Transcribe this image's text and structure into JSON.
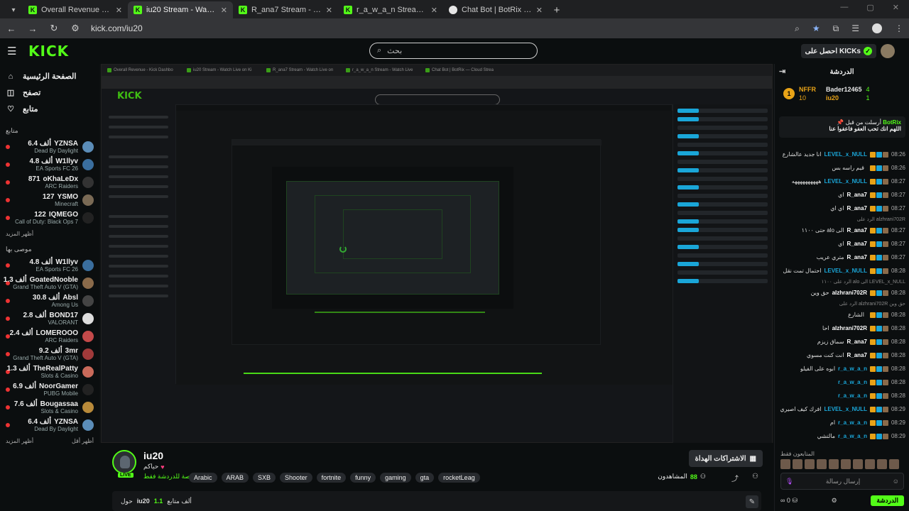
{
  "browser": {
    "tabs": [
      {
        "title": "Overall Revenue - Kick Dashbo",
        "active": false,
        "icon": "kick-icon"
      },
      {
        "title": "iu20 Stream - Watch Live on Ki",
        "active": true,
        "icon": "kick-icon"
      },
      {
        "title": "R_ana7 Stream - Watch Live on",
        "active": false,
        "icon": "kick-icon"
      },
      {
        "title": "r_a_w_a_n Stream - Watch Live",
        "active": false,
        "icon": "kick-icon"
      },
      {
        "title": "Chat Bot | BotRix — Cloud Strea",
        "active": false,
        "icon": "botrix-icon"
      }
    ],
    "url": "kick.com/iu20"
  },
  "header": {
    "search_placeholder": "بحث",
    "get_kicks": "احصل على KICKs"
  },
  "sidebar": {
    "nav": [
      {
        "label": "الصفحة الرئيسية",
        "icon": "home-icon"
      },
      {
        "label": "تصفح",
        "icon": "browse-icon"
      },
      {
        "label": "متابع",
        "icon": "heart-icon"
      }
    ],
    "following_title": "متابع",
    "following": [
      {
        "name": "YZNSA",
        "viewers": "6.4 ألف",
        "category": "Dead By Daylight",
        "color": "#5b8db8"
      },
      {
        "name": "W1llyv",
        "viewers": "4.8 ألف",
        "category": "EA Sports FC 26",
        "color": "#3a6e9e"
      },
      {
        "name": "oKhaLeDx",
        "viewers": "871",
        "category": "ARC Raiders",
        "color": "#333333"
      },
      {
        "name": "YSMO",
        "viewers": "127",
        "category": "Minecraft",
        "color": "#7a6a55"
      },
      {
        "name": "IQMEGO",
        "viewers": "122",
        "category": "Call of Duty: Black Ops 7",
        "color": "#222222"
      }
    ],
    "show_more_1": "أظهر المزيد",
    "recommended_title": "موصى بها",
    "recommended": [
      {
        "name": "W1llyv",
        "viewers": "4.8 ألف",
        "category": "EA Sports FC 26",
        "color": "#3a6e9e"
      },
      {
        "name": "GoatedNooble",
        "viewers": "1.3 ألف",
        "category": "Grand Theft Auto V (GTA)",
        "color": "#8a6a4a"
      },
      {
        "name": "Absl",
        "viewers": "30.8 ألف",
        "category": "Among Us",
        "color": "#444444"
      },
      {
        "name": "BOND17",
        "viewers": "2.8 ألف",
        "category": "VALORANT",
        "color": "#dddddd"
      },
      {
        "name": "LOMEROOO",
        "viewers": "2.4 ألف",
        "category": "ARC Raiders",
        "color": "#c34a4a"
      },
      {
        "name": "3mr",
        "viewers": "9.2 ألف",
        "category": "Grand Theft Auto V (GTA)",
        "color": "#a03a3a"
      },
      {
        "name": "TheRealPatty",
        "viewers": "1.3 ألف",
        "category": "Slots & Casino",
        "color": "#c96a5a"
      },
      {
        "name": "NoorGamer",
        "viewers": "6.9 ألف",
        "category": "PUBG Mobile",
        "color": "#222222"
      },
      {
        "name": "Bougassaa",
        "viewers": "7.6 ألف",
        "category": "Slots & Casino",
        "color": "#b88a3a"
      },
      {
        "name": "YZNSA",
        "viewers": "6.4 ألف",
        "category": "Dead By Daylight",
        "color": "#5b8db8"
      }
    ],
    "show_more_2": "أظهر المزيد",
    "show_less": "أظهر أقل"
  },
  "stream": {
    "name": "iu20",
    "subtitle": "حياكم",
    "category": "مخصصة للدردشة فقط",
    "live_badge": "LIVE",
    "tags": [
      "Arabic",
      "ARAB",
      "SXB",
      "Shooter",
      "fortnite",
      "funny",
      "gaming",
      "gta",
      "rocketLeag"
    ],
    "subscribe_label": "الاشتراكات الهداة",
    "viewers_label": "المشاهدون",
    "viewers_count": "88",
    "about_label": "حول",
    "about_name": "iu20",
    "followers_label": "ألف متابع",
    "followers_count": "1.1"
  },
  "chat": {
    "title": "الدردشة",
    "leaderboard": {
      "name1": "NFFR",
      "val1": "10",
      "name2": "Bader12465",
      "val2": "4",
      "name3": "iu20",
      "val3": "1"
    },
    "pinned_author": "BotRix",
    "pinned_header": "أرسلت من قبل",
    "pinned_text": "اللهم انك تحب العفو فاعفوا عنا",
    "messages": [
      {
        "time": "08:26",
        "user": "LEVEL_x_NULL",
        "color": "#1aa6d8",
        "text": "انا جديد عالشارع"
      },
      {
        "time": "08:26",
        "user": "",
        "color": "#1aa6d8",
        "text": "قيم راسه بس"
      },
      {
        "time": "08:27",
        "user": "LEVEL_x_NULL",
        "color": "#1aa6d8",
        "text": "ههههههههههه"
      },
      {
        "time": "08:27",
        "user": "R_ana7",
        "color": "#ffffff",
        "text": "اي"
      },
      {
        "time": "08:27",
        "user": "R_ana7",
        "color": "#ffffff",
        "text": "اي اي"
      },
      {
        "time": "",
        "user": "",
        "color": "#888888",
        "text": "الرد على alzhrani702R",
        "reply": true
      },
      {
        "time": "08:27",
        "user": "R_ana7",
        "color": "#ffffff",
        "text": "حتى ١١٠٠ alo الى"
      },
      {
        "time": "08:27",
        "user": "R_ana7",
        "color": "#ffffff",
        "text": "اي"
      },
      {
        "time": "08:27",
        "user": "R_ana7",
        "color": "#ffffff",
        "text": "متري عريب"
      },
      {
        "time": "08:28",
        "user": "LEVEL_x_NULL",
        "color": "#1aa6d8",
        "text": "احتمال تمت نقل"
      },
      {
        "time": "",
        "user": "",
        "color": "#888888",
        "text": "الرد على ١١٠٠ alo الى LEVEL_x_NULL",
        "reply": true
      },
      {
        "time": "08:28",
        "user": "alzhrani702R",
        "color": "#ffffff",
        "text": "حق وين"
      },
      {
        "time": "",
        "user": "",
        "color": "#888888",
        "text": "الرد على alzhrani702R حق وين",
        "reply": true
      },
      {
        "time": "08:28",
        "user": "",
        "color": "#ffffff",
        "text": "الشارع"
      },
      {
        "time": "08:28",
        "user": "alzhrani702R",
        "color": "#ffffff",
        "text": "احا"
      },
      {
        "time": "08:28",
        "user": "R_ana7",
        "color": "#ffffff",
        "text": "سماق زيزم"
      },
      {
        "time": "08:28",
        "user": "R_ana7",
        "color": "#ffffff",
        "text": "انت كنت مسوي"
      },
      {
        "time": "08:28",
        "user": "r_a_w_a_n",
        "color": "#1aa6d8",
        "text": "ابوه على الفيلو"
      },
      {
        "time": "08:28",
        "user": "r_a_w_a_n",
        "color": "#1aa6d8",
        "text": ""
      },
      {
        "time": "08:28",
        "user": "r_a_w_a_n",
        "color": "#1aa6d8",
        "text": ""
      },
      {
        "time": "08:29",
        "user": "LEVEL_x_NULL",
        "color": "#1aa6d8",
        "text": "افرك كيف اصيري"
      },
      {
        "time": "08:29",
        "user": "r_a_w_a_n",
        "color": "#1aa6d8",
        "text": "ام"
      },
      {
        "time": "08:29",
        "user": "r_a_w_a_n",
        "color": "#1aa6d8",
        "text": "مالتشي"
      }
    ],
    "followers_only": "المتابعون فقط",
    "input_placeholder": "إرسال رسالة",
    "send_label": "الدردشة",
    "points": "0"
  },
  "colors": {
    "accent": "#53fc18",
    "chat_blue": "#1aa6d8"
  }
}
